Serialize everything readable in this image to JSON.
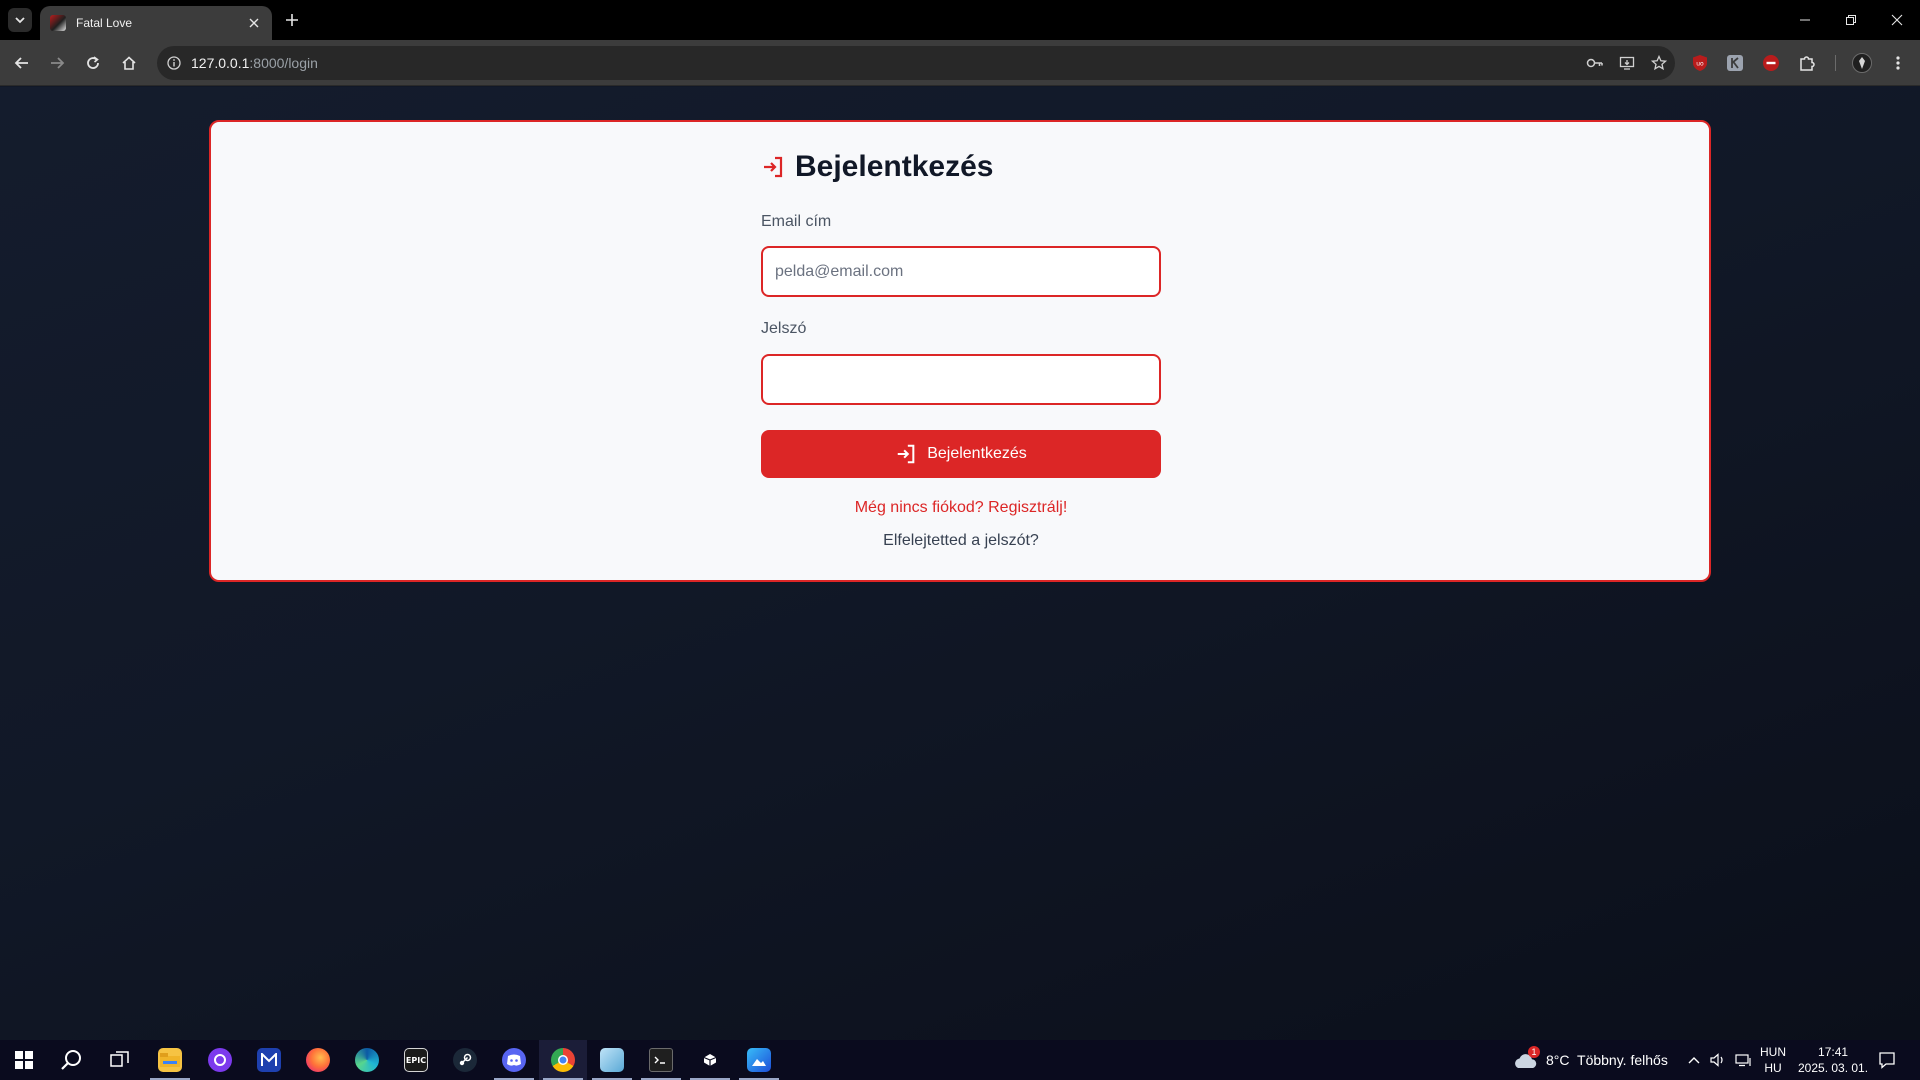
{
  "browser": {
    "tab_title": "Fatal Love",
    "url_host": "127.0.0.1",
    "url_rest": ":8000/login"
  },
  "login": {
    "title": "Bejelentkezés",
    "email_label": "Email cím",
    "email_placeholder": "pelda@email.com",
    "email_value": "",
    "password_label": "Jelszó",
    "password_value": "",
    "submit_label": "Bejelentkezés",
    "register_link": "Még nincs fiókod? Regisztrálj!",
    "forgot_link": "Elfelejtetted a jelszót?"
  },
  "taskbar": {
    "apps": [
      "start-icon",
      "search-icon",
      "task-view-icon",
      "file-explorer-icon",
      "github-desktop-icon",
      "app-icon",
      "firefox-icon",
      "edge-icon",
      "epic-games-icon",
      "steam-icon",
      "discord-icon",
      "chrome-icon",
      "notepad-icon",
      "terminal-icon",
      "unity-icon",
      "photos-icon"
    ],
    "epic_label": "EPIC",
    "weather": "8°C  Többny. felhős",
    "weather_badge": "1",
    "lang_top": "HUN",
    "lang_bottom": "HU",
    "time": "17:41",
    "date": "2025. 03. 01."
  },
  "colors": {
    "accent": "#dc2626",
    "page_bg": "#111827",
    "card_bg": "#f8f9fb"
  }
}
